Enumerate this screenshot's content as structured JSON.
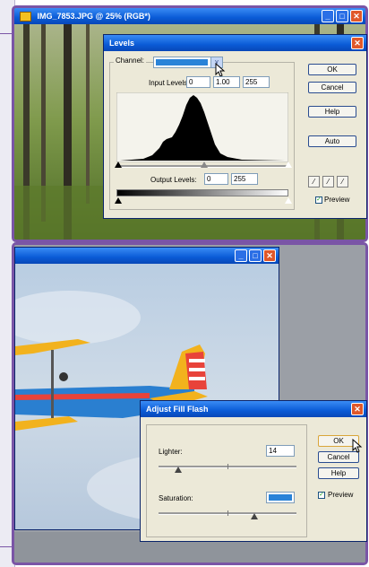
{
  "photo_window": {
    "title": "IMG_7853.JPG @ 25% (RGB*)"
  },
  "levels": {
    "title": "Levels",
    "channel_label": "Channel:",
    "input_levels_label": "Input Levels:",
    "input_black": "0",
    "input_gamma": "1.00",
    "input_white": "255",
    "output_levels_label": "Output Levels:",
    "output_black": "0",
    "output_white": "255",
    "buttons": {
      "ok": "OK",
      "cancel": "Cancel",
      "help": "Help",
      "auto": "Auto"
    },
    "preview_label": "Preview"
  },
  "airplane_window": {
    "title": ""
  },
  "fill_flash": {
    "title": "Adjust Fill Flash",
    "lighter_label": "Lighter:",
    "lighter_value": "14",
    "saturation_label": "Saturation:",
    "buttons": {
      "ok": "OK",
      "cancel": "Cancel",
      "help": "Help"
    },
    "preview_label": "Preview"
  },
  "colors": {
    "title_blue": "#0a5bd6",
    "purple_frame": "#7a55a6",
    "dialog_bg": "#ece9d8",
    "close_red": "#e0582a",
    "sky": "#c7d6e6",
    "plane_blue": "#2a7fd0",
    "plane_yellow": "#f2b21d"
  },
  "icons": {
    "app": "photoshop-elements-icon",
    "minimize": "minimize-icon",
    "maximize": "maximize-icon",
    "close": "close-icon",
    "dropdown": "chevron-down-icon",
    "eyedroppers": [
      "black-eyedropper-icon",
      "gray-eyedropper-icon",
      "white-eyedropper-icon"
    ],
    "cursor": "mouse-pointer-icon"
  }
}
